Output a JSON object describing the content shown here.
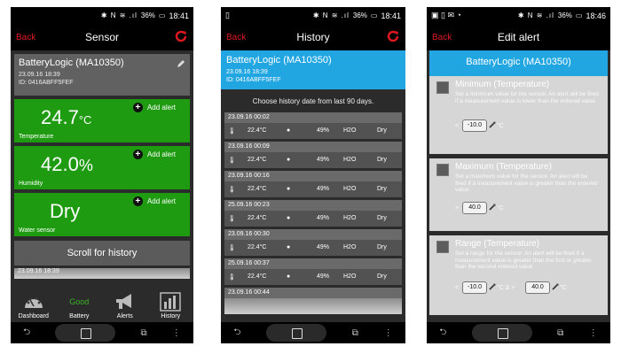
{
  "status": {
    "battery": "36%",
    "time1": "18:41",
    "time2": "18:41",
    "time3": "18:46"
  },
  "colors": {
    "accent_red": "#e0191f",
    "green": "#1e9b11",
    "blue": "#21a6e2"
  },
  "screen1": {
    "back": "Back",
    "title": "Sensor",
    "sensor_name": "BatteryLogic (MA10350)",
    "date": "23.09.16 18:39",
    "id": "ID: 0416ABFF5FEF",
    "tiles": [
      {
        "value": "24.7",
        "unit": "°C",
        "label": "Temperature",
        "add": "Add alert"
      },
      {
        "value": "42.0",
        "unit": "%",
        "label": "Humidity",
        "add": "Add alert"
      },
      {
        "value": "Dry",
        "unit": "",
        "label": "Water sensor",
        "add": "Add alert"
      }
    ],
    "scroll": "Scroll for history",
    "peek_date": "23.09.16 18:39",
    "tabs": [
      {
        "label": "Dashboard",
        "icon": "gauge-icon"
      },
      {
        "label": "Battery",
        "status": "Good"
      },
      {
        "label": "Alerts",
        "icon": "megaphone-icon"
      },
      {
        "label": "History",
        "icon": "bar-chart-icon"
      }
    ]
  },
  "screen2": {
    "back": "Back",
    "title": "History",
    "sensor_name": "BatteryLogic (MA10350)",
    "date": "23.09.16 18:39",
    "id": "ID: 0416ABFF5FEF",
    "choose": "Choose history date from last 90 days.",
    "rows": [
      {
        "date": "23.09.16 00:02",
        "temp": "22.4°C",
        "hum": "49%",
        "water": "Dry"
      },
      {
        "date": "23.09.16 00:09",
        "temp": "22.4°C",
        "hum": "49%",
        "water": "Dry"
      },
      {
        "date": "23.09.16 00:16",
        "temp": "22.4°C",
        "hum": "49%",
        "water": "Dry"
      },
      {
        "date": "25.09.16 00:23",
        "temp": "22.4°C",
        "hum": "49%",
        "water": "Dry"
      },
      {
        "date": "23.09.16 00:30",
        "temp": "22.4°C",
        "hum": "49%",
        "water": "Dry"
      },
      {
        "date": "25.09.16 00:37",
        "temp": "22.4°C",
        "hum": "49%",
        "water": "Dry"
      },
      {
        "date": "23.09.16 00:44",
        "temp": "",
        "hum": "",
        "water": ""
      }
    ],
    "h2o": "H2O"
  },
  "screen3": {
    "back": "Back",
    "title": "Edit alert",
    "sensor_name": "BatteryLogic (MA10350)",
    "min": {
      "title": "Minimum (Temperature)",
      "desc": "Set a minimum value for the sensor. An alert will be fired if a measurement value is lower than the entered value.",
      "op": "<",
      "value": "-10.0",
      "unit": "°C"
    },
    "max": {
      "title": "Maximum (Temperature)",
      "desc": "Set a maximum value for the sensor. An alert will be fired if a measurement value is greater than the entered value.",
      "op": ">",
      "value": "40.0",
      "unit": "°C"
    },
    "range": {
      "title": "Range (Temperature)",
      "desc": "Set a range for the sensor. An alert will be fired if a measurement value is greater than the first or greater than the second entered value",
      "op": "<",
      "value1": "-10.0",
      "mid": "°C & >",
      "value2": "40.0",
      "unit": "°C"
    }
  }
}
